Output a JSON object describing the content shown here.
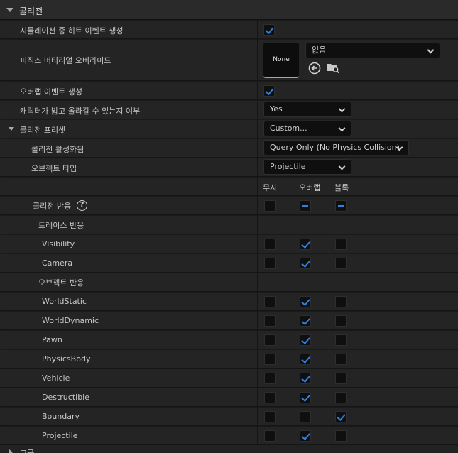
{
  "section": {
    "title": "콜리전"
  },
  "props": {
    "sim_hit": {
      "label": "시뮬레이션 중 히트 이벤트 생성",
      "checked": true
    },
    "phys_mat": {
      "label": "피직스 머티리얼 오버라이드",
      "thumb": "None",
      "value": "없음"
    },
    "overlap": {
      "label": "오버랩 이벤트 생성",
      "checked": true
    },
    "step_on": {
      "label": "캐릭터가 밟고 올라갈 수 있는지 여부",
      "value": "Yes"
    },
    "preset": {
      "label": "콜리전 프리셋",
      "value": "Custom..."
    },
    "enabled": {
      "label": "콜리전 활성화됨",
      "value": "Query Only (No Physics Collision)"
    },
    "obj_type": {
      "label": "오브젝트 타입",
      "value": "Projectile"
    }
  },
  "columns": [
    "무시",
    "오버랩",
    "블록"
  ],
  "response": {
    "label": "콜리전 반응",
    "help": "?"
  },
  "trace": {
    "label": "트레이스 반응",
    "items": [
      {
        "label": "Visibility",
        "state": 1
      },
      {
        "label": "Camera",
        "state": 1
      }
    ]
  },
  "object": {
    "label": "오브젝트 반응",
    "items": [
      {
        "label": "WorldStatic",
        "state": 1
      },
      {
        "label": "WorldDynamic",
        "state": 1
      },
      {
        "label": "Pawn",
        "state": 1
      },
      {
        "label": "PhysicsBody",
        "state": 1
      },
      {
        "label": "Vehicle",
        "state": 1
      },
      {
        "label": "Destructible",
        "state": 1
      },
      {
        "label": "Boundary",
        "state": 2
      },
      {
        "label": "Projectile",
        "state": 1
      }
    ]
  },
  "next_section": {
    "title": "고급"
  },
  "colors": {
    "accent": "#2f7fe4",
    "thumb_border": "#c8a93a"
  }
}
